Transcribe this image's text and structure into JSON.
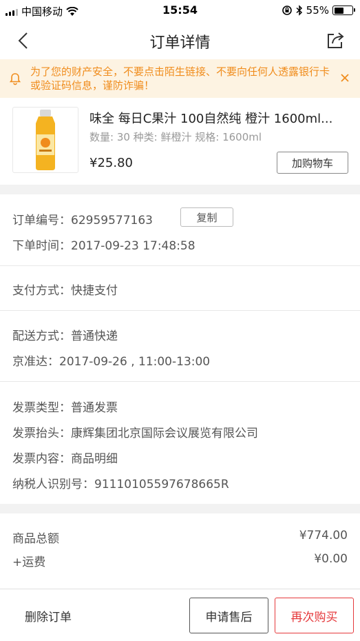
{
  "status_bar": {
    "carrier": "中国移动",
    "time": "15:54",
    "battery": "55%",
    "battery_level": 0.55,
    "icons": [
      "signal-icon",
      "wifi-icon",
      "orientation-lock-icon",
      "bluetooth-icon",
      "battery-icon"
    ]
  },
  "nav": {
    "title": "订单详情",
    "icons": [
      "back-icon",
      "share-icon"
    ]
  },
  "notice": {
    "text": "为了您的财产安全，不要点击陌生链接、不要向任何人透露银行卡或验证码信息，谨防诈骗！",
    "color": "#f08c1c",
    "background": "#fdf3e2"
  },
  "product": {
    "name": "味全 每日C果汁 100自然纯 橙汁 1600ml...",
    "spec": "数量: 30 种类: 鲜橙汁 规格: 1600ml",
    "price": "¥25.80",
    "cart_button": "加购物车"
  },
  "order": {
    "number": "订单编号：62959577163",
    "copy_button": "复制",
    "time": "下单时间：2017-09-23 17:48:58"
  },
  "payment": {
    "method": "支付方式：快捷支付"
  },
  "delivery": {
    "method": "配送方式：普通快递",
    "jzd": "京准达：2017-09-26 , 11:00-13:00"
  },
  "invoice": {
    "type": "发票类型：普通发票",
    "title": "发票抬头：康辉集团北京国际会议展览有限公司",
    "content": "发票内容：商品明细",
    "tax_id": "纳税人识别号：91110105597678665R"
  },
  "summary": {
    "total_label": "商品总额",
    "total_value": "¥774.00",
    "shipping_label": "+运费",
    "shipping_value": "¥0.00"
  },
  "actions": {
    "delete": "删除订单",
    "after_sale": "申请售后",
    "rebuy": "再次购买",
    "accent_color": "#e5383b"
  }
}
